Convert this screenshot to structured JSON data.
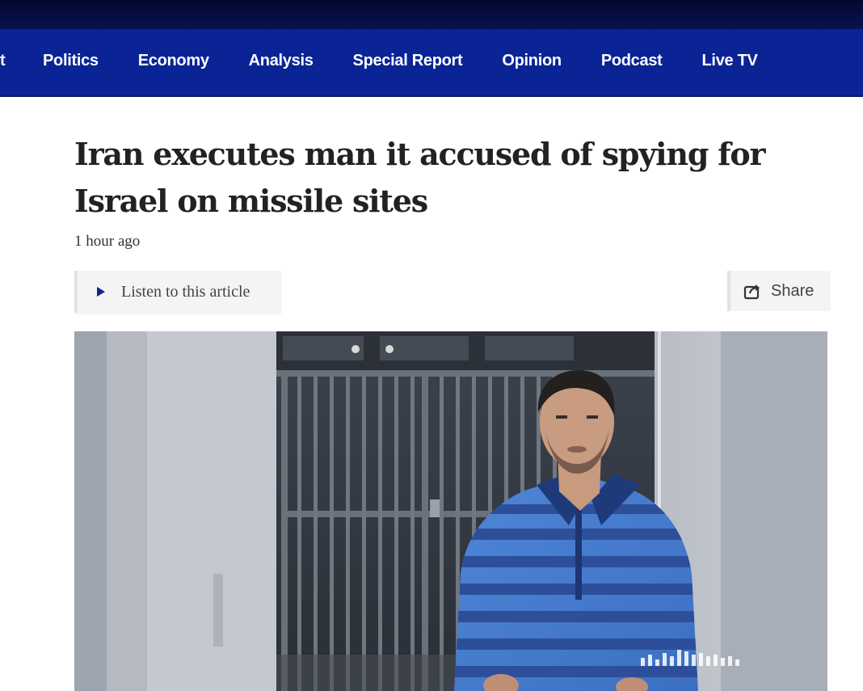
{
  "nav": {
    "cut_item": "t",
    "items": [
      "Politics",
      "Economy",
      "Analysis",
      "Special Report",
      "Opinion",
      "Podcast",
      "Live TV"
    ]
  },
  "article": {
    "headline": "Iran executes man it accused of spying for Israel on missile sites",
    "timestamp": "1 hour ago",
    "listen_label": "Listen to this article",
    "share_label": "Share"
  },
  "icons": {
    "play": "play-icon",
    "share": "share-icon"
  },
  "colors": {
    "nav_background": "#0a2496",
    "top_strip": "#010830",
    "headline_text": "#222222",
    "play_accent": "#0a2496"
  }
}
